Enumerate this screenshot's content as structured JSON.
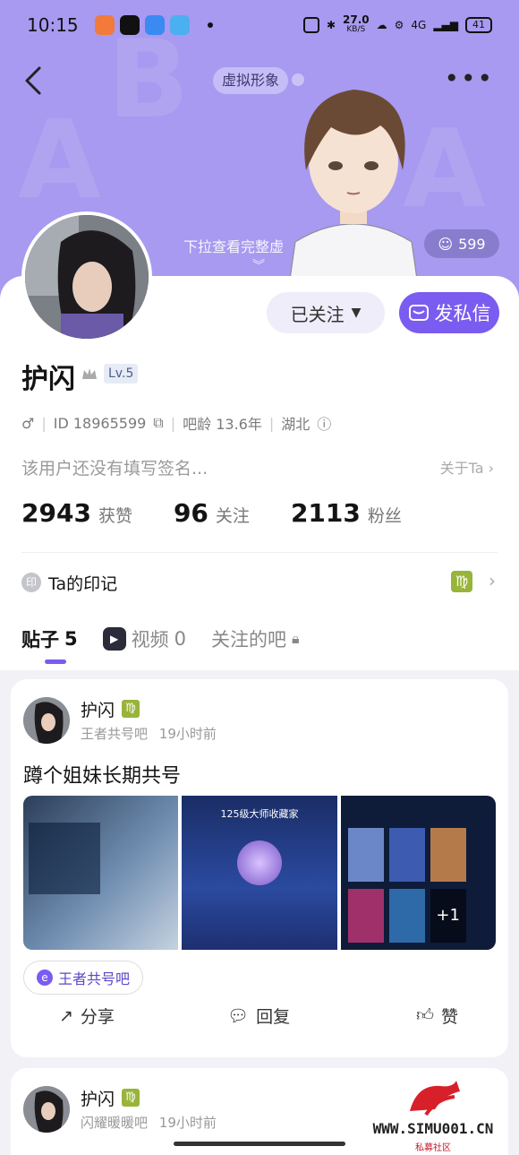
{
  "status_bar": {
    "time": "10:15",
    "net_speed": "27.0",
    "net_unit": "KB/S",
    "signal": "4G",
    "battery": "41"
  },
  "header": {
    "virtual_tag": "虚拟形象",
    "pull_hint": "下拉查看完整虚",
    "likes_count": "599"
  },
  "actions": {
    "follow_label": "已关注",
    "message_label": "发私信"
  },
  "profile": {
    "name": "护闪",
    "level": "Lv.5",
    "id": "ID 18965599",
    "bar_age": "吧龄 13.6年",
    "location": "湖北",
    "signature": "该用户还没有填写签名...",
    "about": "关于Ta"
  },
  "stats": [
    {
      "num": "2943",
      "label": "获赞"
    },
    {
      "num": "96",
      "label": "关注"
    },
    {
      "num": "2113",
      "label": "粉丝"
    }
  ],
  "mark": {
    "icon_text": "印",
    "label": "Ta的印记",
    "zodiac": "♍"
  },
  "tabs": [
    {
      "label": "贴子",
      "count": "5"
    },
    {
      "label": "视频",
      "count": "0"
    },
    {
      "label": "关注的吧"
    }
  ],
  "posts": [
    {
      "author": "护闪",
      "forum": "王者共号吧",
      "time": "19小时前",
      "title": "蹲个姐妹长期共号",
      "img2_title": "125级大师收藏家",
      "img3_more": "+1",
      "tag": "王者共号吧",
      "share": "分享",
      "reply": "回复",
      "like": "赞"
    },
    {
      "author": "护闪",
      "forum": "闪耀暖暖吧",
      "time": "19小时前"
    }
  ],
  "watermark": {
    "url": "WWW.SIMU001.CN",
    "sub": "私募社区"
  },
  "colors": {
    "accent": "#7a5cf0",
    "hero": "#a79af0",
    "zodiac": "#98b43a"
  }
}
